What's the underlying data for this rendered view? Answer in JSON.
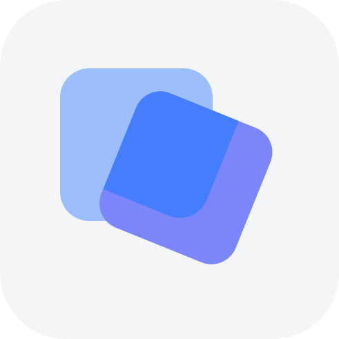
{
  "icon": {
    "name": "overlapping-squares-app-icon",
    "colors": {
      "tile_background": "#F3F5F7",
      "back_square": "#9CBFFC",
      "front_square": "#7A86F9",
      "overlap": "#447DFE"
    }
  }
}
